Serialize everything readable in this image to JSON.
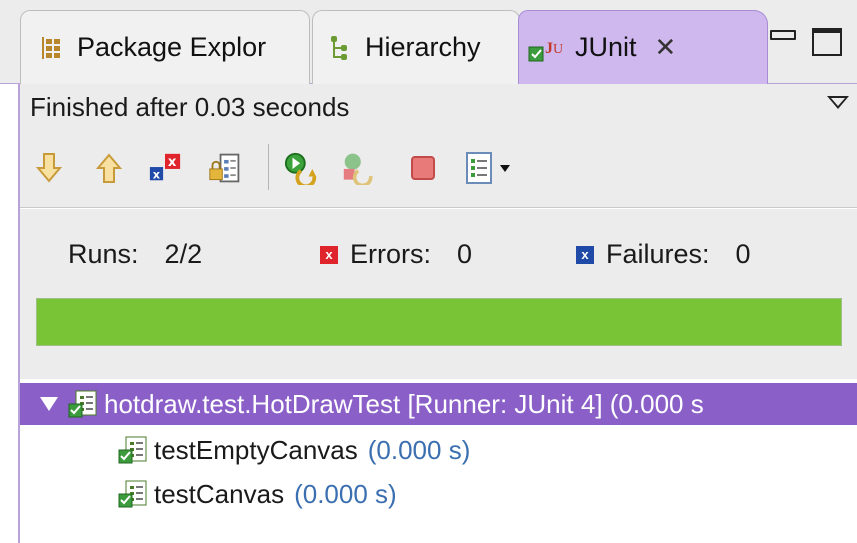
{
  "tabs": [
    {
      "label": "Package Explor",
      "icon": "package-icon",
      "active": false
    },
    {
      "label": "Hierarchy",
      "icon": "hierarchy-icon",
      "active": false
    },
    {
      "label": "JUnit",
      "icon": "junit-icon",
      "active": true
    }
  ],
  "status": {
    "text": "Finished after 0.03 seconds"
  },
  "toolbar": {
    "buttons": [
      {
        "name": "next-failure-icon"
      },
      {
        "name": "previous-failure-icon"
      },
      {
        "name": "show-failures-only-icon"
      },
      {
        "name": "scroll-lock-icon"
      },
      {
        "name": "rerun-test-icon"
      },
      {
        "name": "rerun-failed-first-icon"
      },
      {
        "name": "stop-icon"
      },
      {
        "name": "test-run-history-icon"
      }
    ]
  },
  "counters": {
    "runs_label": "Runs:",
    "runs_value": "2/2",
    "errors_label": "Errors:",
    "errors_value": "0",
    "failures_label": "Failures:",
    "failures_value": "0",
    "error_color": "#e0242b",
    "failure_color": "#1f4aa8"
  },
  "progress": {
    "fraction": 1.0,
    "color": "#79c436"
  },
  "tree": {
    "root": {
      "label": "hotdraw.test.HotDrawTest [Runner: JUnit 4] (0.000 s"
    },
    "children": [
      {
        "name": "testEmptyCanvas",
        "time": "(0.000 s)"
      },
      {
        "name": "testCanvas",
        "time": "(0.000 s)"
      }
    ]
  }
}
